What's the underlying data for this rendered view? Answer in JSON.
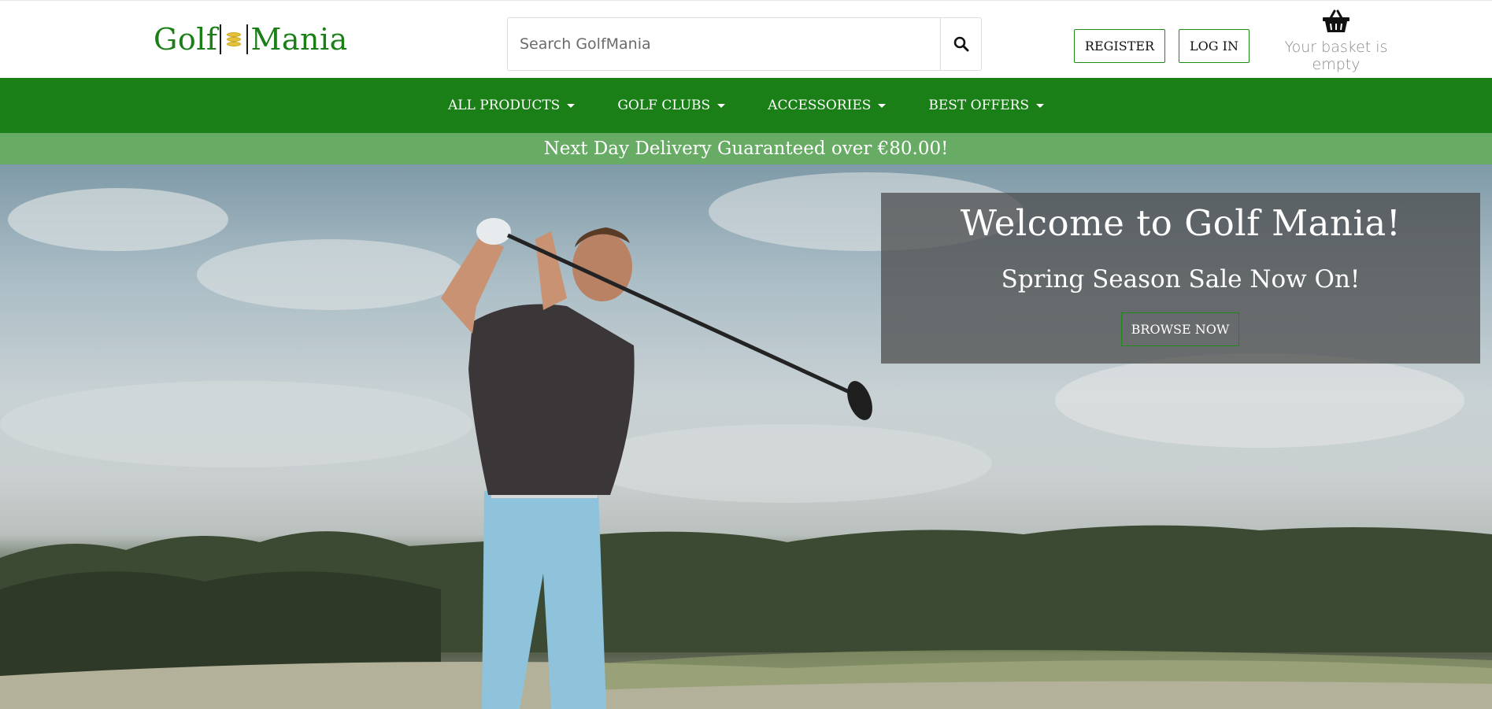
{
  "header": {
    "logo_left": "Golf",
    "logo_right": "Mania",
    "search": {
      "placeholder": "Search GolfMania"
    },
    "register_label": "REGISTER",
    "login_label": "LOG IN",
    "basket_text": "Your basket is empty",
    "icons": {
      "search": "search-icon",
      "basket": "basket-icon",
      "logo": "golf-balls-icon"
    }
  },
  "nav": {
    "items": [
      {
        "label": "ALL PRODUCTS"
      },
      {
        "label": "GOLF CLUBS"
      },
      {
        "label": "ACCESSORIES"
      },
      {
        "label": "BEST OFFERS"
      }
    ]
  },
  "banner": {
    "text": "Next Day Delivery Guaranteed over €80.00!"
  },
  "hero": {
    "title": "Welcome to Golf Mania!",
    "subtitle": "Spring Season Sale Now On!",
    "button_label": "BROWSE NOW"
  },
  "colors": {
    "brand_green": "#1a7f17",
    "banner_green": "#67ab64",
    "button_border": "#1f8a1a"
  }
}
